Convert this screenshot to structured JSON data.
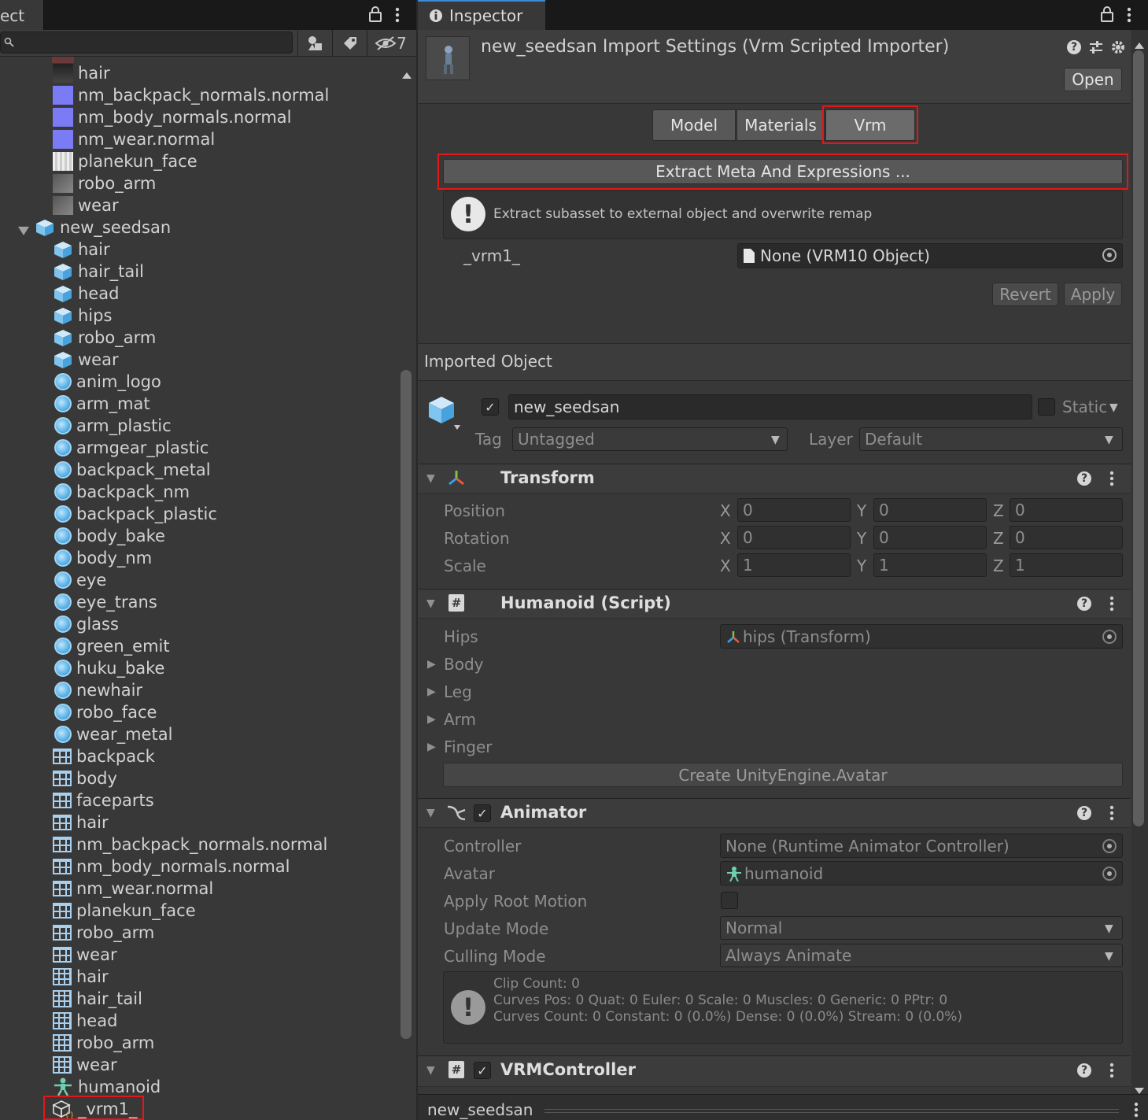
{
  "left_panel": {
    "tab_label": "ect",
    "hidden_count": "7",
    "tree": [
      {
        "label": "hair",
        "icon": "texture-icon",
        "depth": 2
      },
      {
        "label": "nm_backpack_normals.normal",
        "icon": "normal-map-icon",
        "depth": 2
      },
      {
        "label": "nm_body_normals.normal",
        "icon": "normal-map-icon",
        "depth": 2
      },
      {
        "label": "nm_wear.normal",
        "icon": "normal-map-icon",
        "depth": 2
      },
      {
        "label": "planekun_face",
        "icon": "texture-icon",
        "depth": 2
      },
      {
        "label": "robo_arm",
        "icon": "texture-icon",
        "depth": 2
      },
      {
        "label": "wear",
        "icon": "texture-icon",
        "depth": 2
      },
      {
        "label": "new_seedsan",
        "icon": "prefab-icon",
        "depth": 1
      },
      {
        "label": "hair",
        "icon": "mesh-icon",
        "depth": 2
      },
      {
        "label": "hair_tail",
        "icon": "mesh-icon",
        "depth": 2
      },
      {
        "label": "head",
        "icon": "mesh-icon",
        "depth": 2
      },
      {
        "label": "hips",
        "icon": "mesh-icon",
        "depth": 2
      },
      {
        "label": "robo_arm",
        "icon": "mesh-icon",
        "depth": 2
      },
      {
        "label": "wear",
        "icon": "mesh-icon",
        "depth": 2
      },
      {
        "label": "anim_logo",
        "icon": "material-icon",
        "depth": 2
      },
      {
        "label": "arm_mat",
        "icon": "material-icon",
        "depth": 2
      },
      {
        "label": "arm_plastic",
        "icon": "material-icon",
        "depth": 2
      },
      {
        "label": "armgear_plastic",
        "icon": "material-icon",
        "depth": 2
      },
      {
        "label": "backpack_metal",
        "icon": "material-icon",
        "depth": 2
      },
      {
        "label": "backpack_nm",
        "icon": "material-icon",
        "depth": 2
      },
      {
        "label": "backpack_plastic",
        "icon": "material-icon",
        "depth": 2
      },
      {
        "label": "body_bake",
        "icon": "material-icon",
        "depth": 2
      },
      {
        "label": "body_nm",
        "icon": "material-icon",
        "depth": 2
      },
      {
        "label": "eye",
        "icon": "material-icon",
        "depth": 2
      },
      {
        "label": "eye_trans",
        "icon": "material-icon",
        "depth": 2
      },
      {
        "label": "glass",
        "icon": "material-icon",
        "depth": 2
      },
      {
        "label": "green_emit",
        "icon": "material-icon",
        "depth": 2
      },
      {
        "label": "huku_bake",
        "icon": "material-icon",
        "depth": 2
      },
      {
        "label": "newhair",
        "icon": "material-icon",
        "depth": 2
      },
      {
        "label": "robo_face",
        "icon": "material-icon",
        "depth": 2
      },
      {
        "label": "wear_metal",
        "icon": "material-icon",
        "depth": 2
      },
      {
        "label": "backpack",
        "icon": "texture2d-icon",
        "depth": 2
      },
      {
        "label": "body",
        "icon": "texture2d-icon",
        "depth": 2
      },
      {
        "label": "faceparts",
        "icon": "texture2d-icon",
        "depth": 2
      },
      {
        "label": "hair",
        "icon": "texture2d-icon",
        "depth": 2
      },
      {
        "label": "nm_backpack_normals.normal",
        "icon": "texture2d-icon",
        "depth": 2
      },
      {
        "label": "nm_body_normals.normal",
        "icon": "texture2d-icon",
        "depth": 2
      },
      {
        "label": "nm_wear.normal",
        "icon": "texture2d-icon",
        "depth": 2
      },
      {
        "label": "planekun_face",
        "icon": "texture2d-icon",
        "depth": 2
      },
      {
        "label": "robo_arm",
        "icon": "texture2d-icon",
        "depth": 2
      },
      {
        "label": "wear",
        "icon": "texture2d-icon",
        "depth": 2
      },
      {
        "label": "hair",
        "icon": "mesh-grid-icon",
        "depth": 2
      },
      {
        "label": "hair_tail",
        "icon": "mesh-grid-icon",
        "depth": 2
      },
      {
        "label": "head",
        "icon": "mesh-grid-icon",
        "depth": 2
      },
      {
        "label": "robo_arm",
        "icon": "mesh-grid-icon",
        "depth": 2
      },
      {
        "label": "wear",
        "icon": "mesh-grid-icon",
        "depth": 2
      },
      {
        "label": "humanoid",
        "icon": "avatar-icon",
        "depth": 2
      },
      {
        "label": "_vrm1_",
        "icon": "vrm-object-icon",
        "depth": 2
      }
    ]
  },
  "inspector": {
    "tab_label": "Inspector",
    "title": "new_seedsan Import Settings (Vrm Scripted Importer)",
    "open_label": "Open",
    "tabs": [
      "Model",
      "Materials",
      "Vrm"
    ],
    "extract_label": "Extract Meta And Expressions ...",
    "extract_help": "Extract subasset to external object and overwrite remap",
    "remap_label": "_vrm1_",
    "remap_value": "None (VRM10 Object)",
    "revert_label": "Revert",
    "apply_label": "Apply",
    "imported_object_label": "Imported Object",
    "object_name": "new_seedsan",
    "static_label": "Static",
    "tag_label": "Tag",
    "tag_value": "Untagged",
    "layer_label": "Layer",
    "layer_value": "Default",
    "transform": {
      "title": "Transform",
      "rows": [
        {
          "label": "Position",
          "x": "0",
          "y": "0",
          "z": "0"
        },
        {
          "label": "Rotation",
          "x": "0",
          "y": "0",
          "z": "0"
        },
        {
          "label": "Scale",
          "x": "1",
          "y": "1",
          "z": "1"
        }
      ],
      "axis": [
        "X",
        "Y",
        "Z"
      ]
    },
    "humanoid": {
      "title": "Humanoid (Script)",
      "hips_label": "Hips",
      "hips_value": "hips (Transform)",
      "groups": [
        "Body",
        "Leg",
        "Arm",
        "Finger"
      ],
      "create_label": "Create UnityEngine.Avatar"
    },
    "animator": {
      "title": "Animator",
      "controller_label": "Controller",
      "controller_value": "None (Runtime Animator Controller)",
      "avatar_label": "Avatar",
      "avatar_value": "humanoid",
      "root_motion_label": "Apply Root Motion",
      "update_mode_label": "Update Mode",
      "update_mode_value": "Normal",
      "culling_mode_label": "Culling Mode",
      "culling_mode_value": "Always Animate",
      "info_line1": "Clip Count: 0",
      "info_line2": "Curves Pos: 0 Quat: 0 Euler: 0 Scale: 0 Muscles: 0 Generic: 0 PPtr: 0",
      "info_line3": "Curves Count: 0 Constant: 0 (0.0%) Dense: 0 (0.0%) Stream: 0 (0.0%)"
    },
    "vrm_controller": {
      "title": "VRMController"
    },
    "footer_label": "new_seedsan"
  }
}
